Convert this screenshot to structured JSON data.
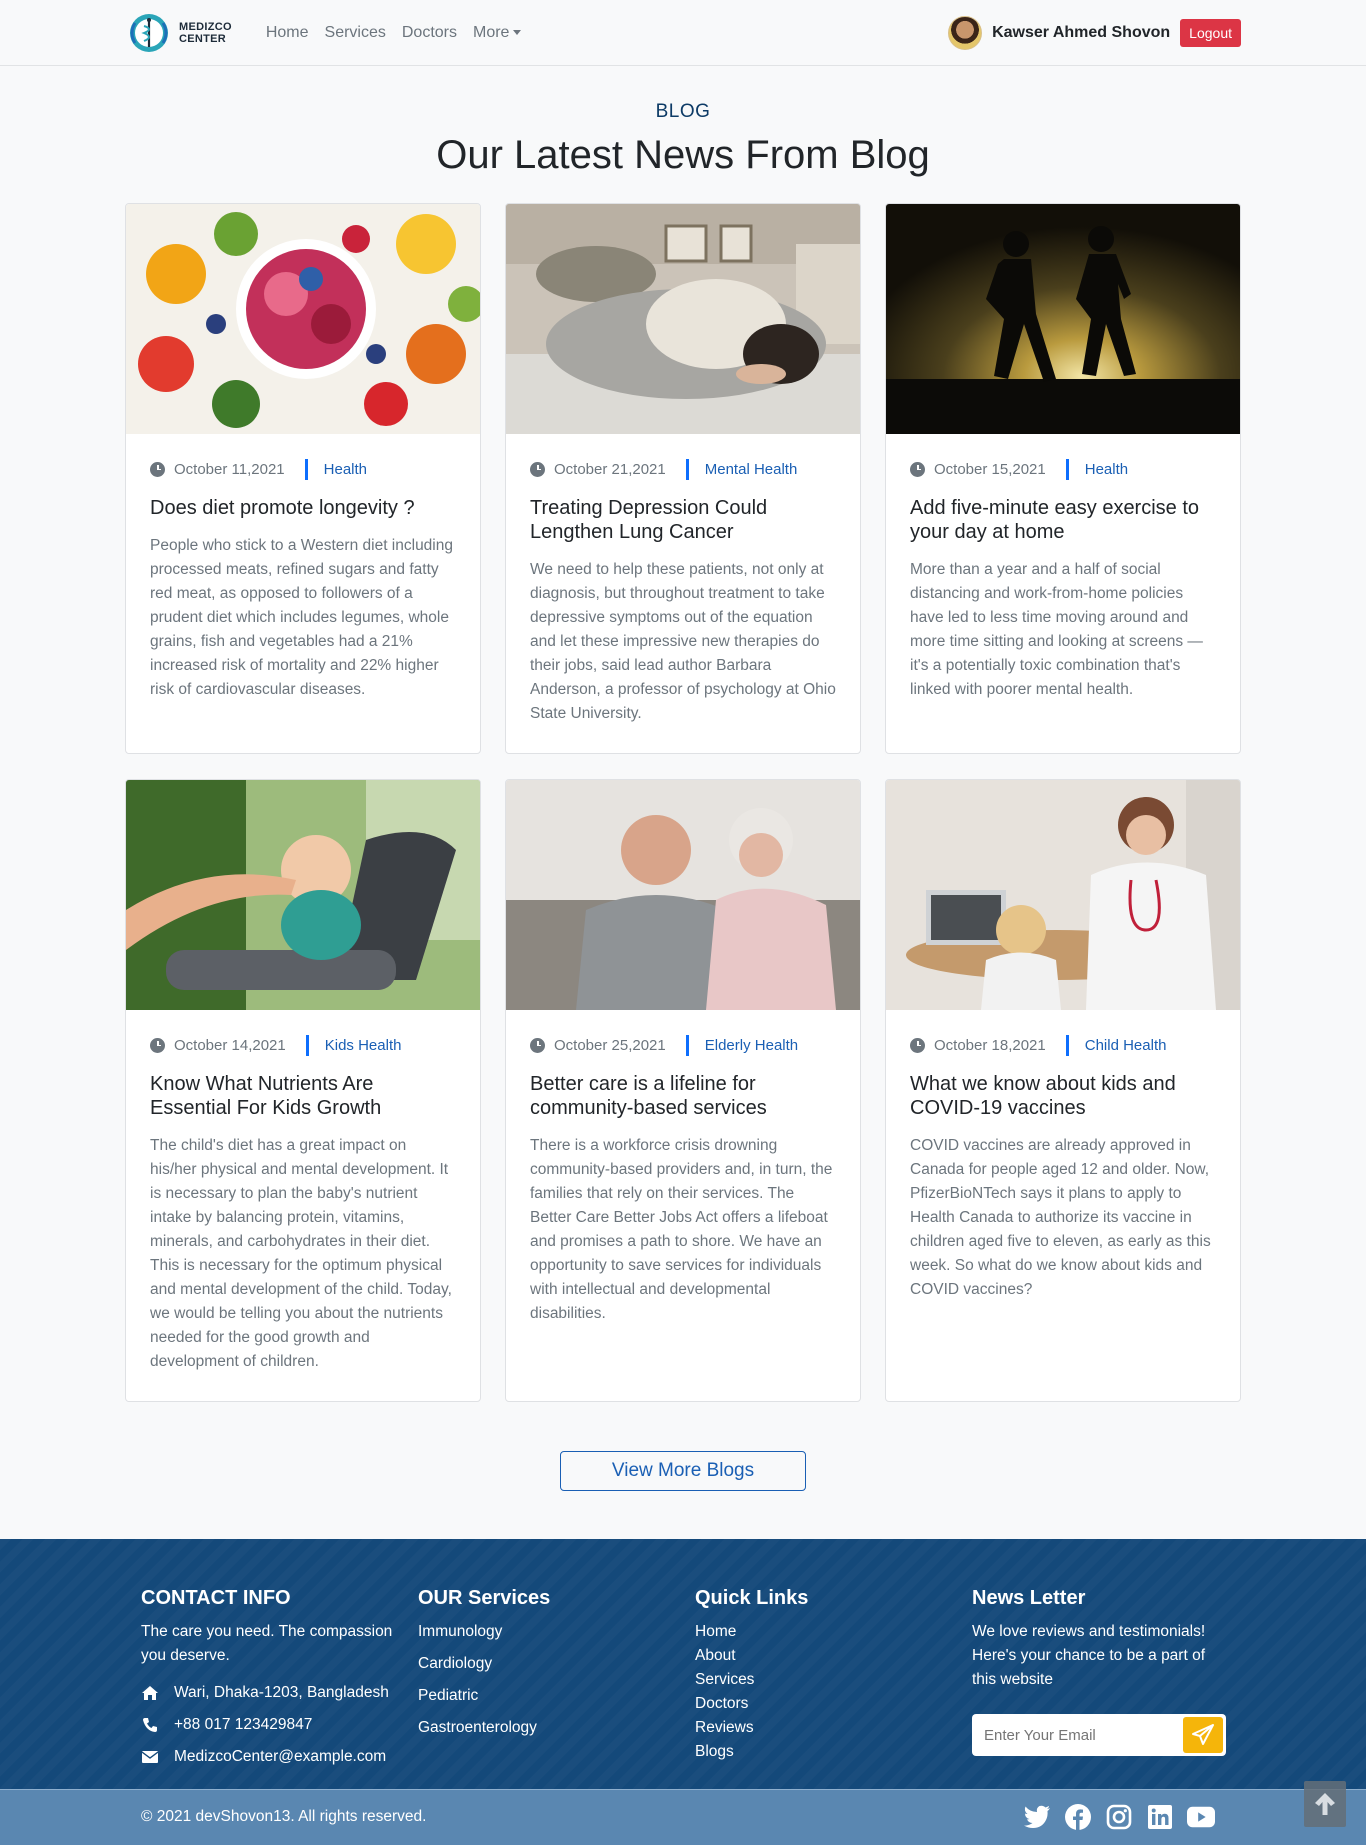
{
  "brand": {
    "line1": "MEDIZCO",
    "line2": "CENTER"
  },
  "nav": {
    "links": [
      "Home",
      "Services",
      "Doctors",
      "More"
    ],
    "user_name": "Kawser Ahmed Shovon",
    "logout_label": "Logout"
  },
  "section": {
    "eyebrow": "BLOG",
    "title": "Our Latest News From Blog"
  },
  "posts": [
    {
      "date": "October 11,2021",
      "category": "Health",
      "title": "Does diet promote longevity ?",
      "text": "People who stick to a Western diet including processed meats, refined sugars and fatty red meat, as opposed to followers of a prudent diet which includes legumes, whole grains, fish and vegetables had a 21% increased risk of mortality and 22% higher risk of cardiovascular diseases."
    },
    {
      "date": "October 21,2021",
      "category": "Mental Health",
      "title": "Treating Depression Could Lengthen Lung Cancer",
      "text": "We need to help these patients, not only at diagnosis, but throughout treatment to take depressive symptoms out of the equation and let these impressive new therapies do their jobs, said lead author Barbara Anderson, a professor of psychology at Ohio State University."
    },
    {
      "date": "October 15,2021",
      "category": "Health",
      "title": "Add five-minute easy exercise to your day at home",
      "text": "More than a year and a half of social distancing and work-from-home policies have led to less time moving around and more time sitting and looking at screens — it's a potentially toxic combination that's linked with poorer mental health."
    },
    {
      "date": "October 14,2021",
      "category": "Kids Health",
      "title": "Know What Nutrients Are Essential For Kids Growth",
      "text": "The child's diet has a great impact on his/her physical and mental development. It is necessary to plan the baby's nutrient intake by balancing protein, vitamins, minerals, and carbohydrates in their diet. This is necessary for the optimum physical and mental development of the child. Today, we would be telling you about the nutrients needed for the good growth and development of children."
    },
    {
      "date": "October 25,2021",
      "category": "Elderly Health",
      "title": "Better care is a lifeline for community-based services",
      "text": "There is a workforce crisis drowning community-based providers and, in turn, the families that rely on their services. The Better Care Better Jobs Act offers a lifeboat and promises a path to shore. We have an opportunity to save services for individuals with intellectual and developmental disabilities."
    },
    {
      "date": "October 18,2021",
      "category": "Child Health",
      "title": "What we know about kids and COVID-19 vaccines",
      "text": "COVID vaccines are already approved in Canada for people aged 12 and older. Now, PfizerBioNTech says it plans to apply to Health Canada to authorize its vaccine in children aged five to eleven, as early as this week. So what do we know about kids and COVID vaccines?"
    }
  ],
  "view_more_label": "View More Blogs",
  "footer": {
    "contact": {
      "heading": "CONTACT INFO",
      "tagline": "The care you need. The compassion you deserve.",
      "address": "Wari, Dhaka-1203, Bangladesh",
      "phone": "+88 017 123429847",
      "email": "MedizcoCenter@example.com"
    },
    "services": {
      "heading": "OUR Services",
      "items": [
        "Immunology",
        "Cardiology",
        "Pediatric",
        "Gastroenterology"
      ]
    },
    "quick_links": {
      "heading": "Quick Links",
      "items": [
        "Home",
        "About",
        "Services",
        "Doctors",
        "Reviews",
        "Blogs"
      ]
    },
    "newsletter": {
      "heading": "News Letter",
      "text": "We love reviews and testimonials! Here's your chance to be a part of this website",
      "placeholder": "Enter Your Email"
    },
    "copyright": "© 2021 devShovon13. All rights reserved.",
    "socials": [
      "twitter-icon",
      "facebook-icon",
      "instagram-icon",
      "linkedin-icon",
      "youtube-icon"
    ]
  },
  "colors": {
    "primary": "#1a5fb4",
    "footer_bg": "#14497a",
    "footer_bottom": "#5a87b1",
    "logout": "#dc3545",
    "send": "#f5b50a"
  }
}
